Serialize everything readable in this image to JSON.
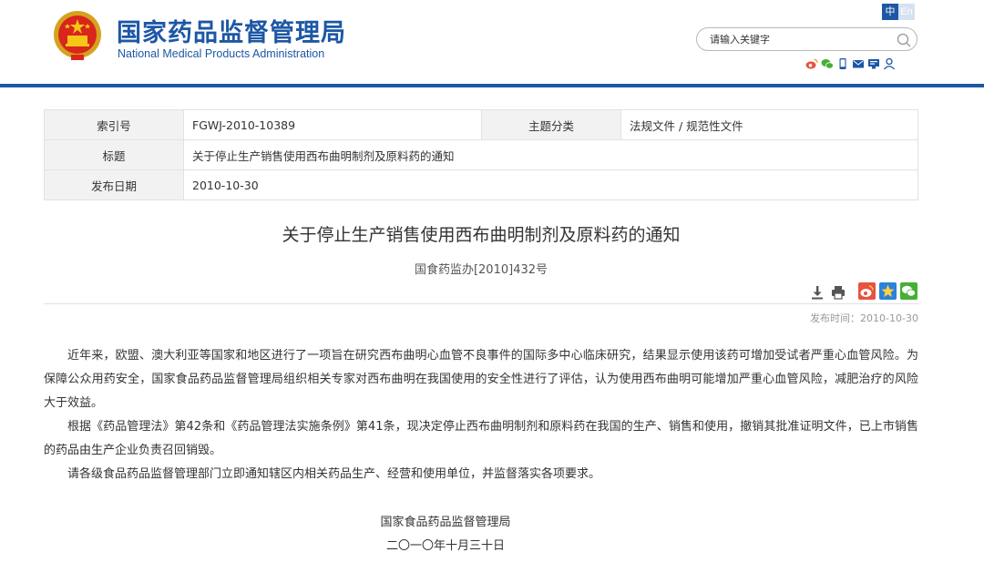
{
  "header": {
    "title_cn": "国家药品监督管理局",
    "title_en": "National Medical Products Administration",
    "lang_cn": "中",
    "lang_en": "En",
    "search_placeholder": "请输入关键字",
    "share_icons": [
      "weibo-icon",
      "wechat-icon",
      "mobile-icon",
      "mail-icon",
      "comment-icon",
      "user-icon"
    ]
  },
  "meta": {
    "index_label": "索引号",
    "index_value": "FGWJ-2010-10389",
    "category_label": "主题分类",
    "category_value": "法规文件 / 规范性文件",
    "title_label": "标题",
    "title_value": "关于停止生产销售使用西布曲明制剂及原料药的通知",
    "date_label": "发布日期",
    "date_value": "2010-10-30"
  },
  "article": {
    "title": "关于停止生产销售使用西布曲明制剂及原料药的通知",
    "doc_number": "国食药监办[2010]432号",
    "publish_time": "发布时间：2010-10-30",
    "paragraphs": [
      "近年来，欧盟、澳大利亚等国家和地区进行了一项旨在研究西布曲明心血管不良事件的国际多中心临床研究，结果显示使用该药可增加受试者严重心血管风险。为保障公众用药安全，国家食品药品监督管理局组织相关专家对西布曲明在我国使用的安全性进行了评估，认为使用西布曲明可能增加严重心血管风险，减肥治疗的风险大于效益。",
      "根据《药品管理法》第42条和《药品管理法实施条例》第41条，现决定停止西布曲明制剂和原料药在我国的生产、销售和使用，撤销其批准证明文件，已上市销售的药品由生产企业负责召回销毁。",
      "请各级食品药品监督管理部门立即通知辖区内相关药品生产、经营和使用单位，并监督落实各项要求。"
    ],
    "signature_org": "国家食品药品监督管理局",
    "signature_date": "二〇一〇年十月三十日"
  },
  "colors": {
    "brand_blue": "#1d57a5",
    "weibo_red": "#e8523f",
    "qzone_blue": "#2b82d9",
    "wechat_green": "#45b035"
  }
}
